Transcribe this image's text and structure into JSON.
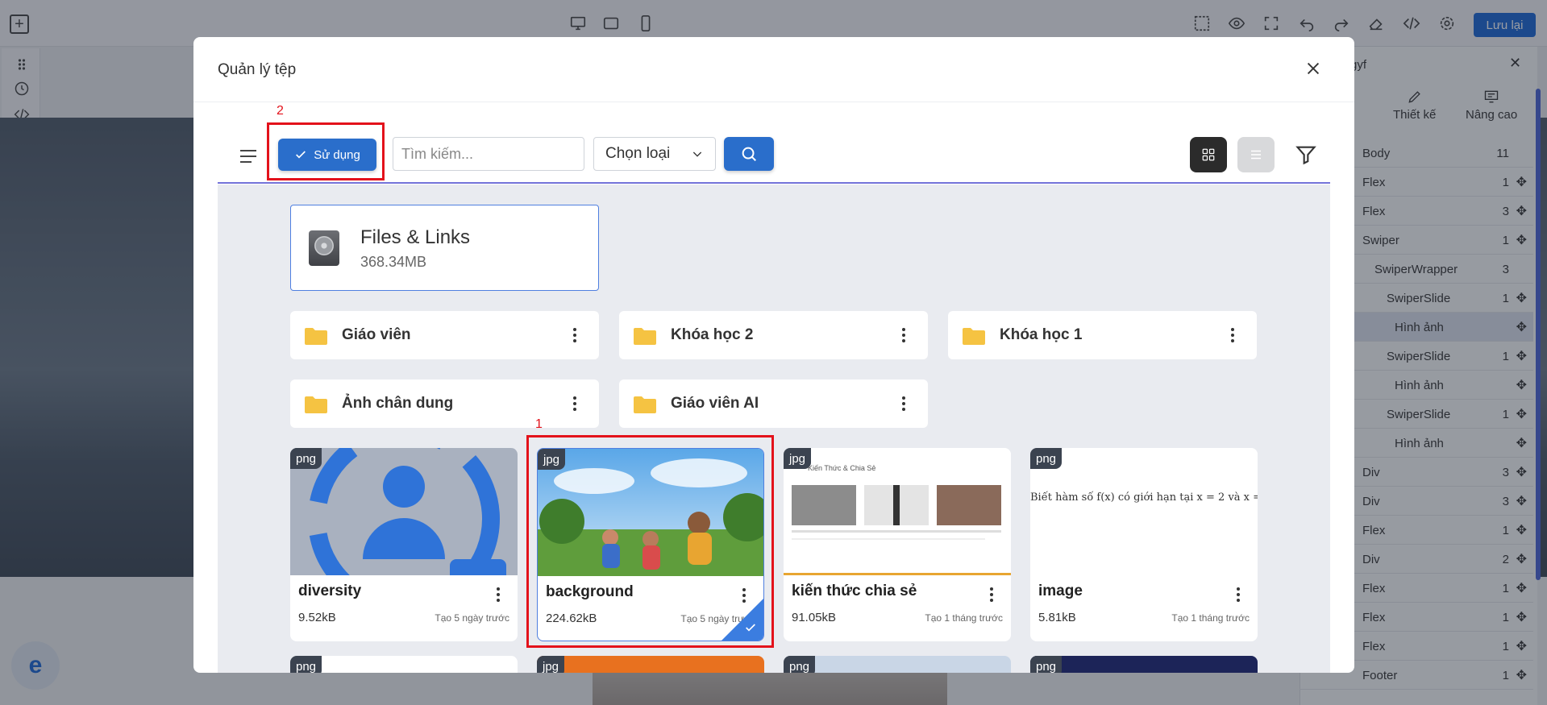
{
  "editor": {
    "save_label": "Lưu lại",
    "right_panel": {
      "header": "gyf",
      "tabs": [
        "Thiết kế",
        "Nâng cao"
      ],
      "tree": [
        {
          "label": "Body",
          "count": "11",
          "move": false
        },
        {
          "label": "Flex",
          "count": "1",
          "move": true
        },
        {
          "label": "Flex",
          "count": "3",
          "move": true
        },
        {
          "label": "Swiper",
          "count": "1",
          "move": true
        },
        {
          "label": "SwiperWrapper",
          "count": "3",
          "move": false
        },
        {
          "label": "SwiperSlide",
          "count": "1",
          "move": true
        },
        {
          "label": "Hình ảnh",
          "count": "",
          "move": true
        },
        {
          "label": "SwiperSlide",
          "count": "1",
          "move": true
        },
        {
          "label": "Hình ảnh",
          "count": "",
          "move": true
        },
        {
          "label": "SwiperSlide",
          "count": "1",
          "move": true
        },
        {
          "label": "Hình ảnh",
          "count": "",
          "move": true
        },
        {
          "label": "Div",
          "count": "3",
          "move": true
        },
        {
          "label": "Div",
          "count": "3",
          "move": true
        },
        {
          "label": "Flex",
          "count": "1",
          "move": true
        },
        {
          "label": "Div",
          "count": "2",
          "move": true
        },
        {
          "label": "Flex",
          "count": "1",
          "move": true
        },
        {
          "label": "Flex",
          "count": "1",
          "move": true
        },
        {
          "label": "Flex",
          "count": "1",
          "move": true
        },
        {
          "label": "Footer",
          "count": "1",
          "move": true
        }
      ]
    }
  },
  "modal": {
    "title": "Quản lý tệp",
    "use_label": "Sử dụng",
    "search_placeholder": "Tìm kiếm...",
    "type_label": "Chọn loại",
    "storage": {
      "name": "Files & Links",
      "size": "368.34MB"
    },
    "folders": [
      "Giáo viên",
      "Khóa học 2",
      "Khóa học 1",
      "Ảnh chân dung",
      "Giáo viên AI"
    ],
    "files": [
      {
        "type": "png",
        "name": "diversity",
        "size": "9.52kB",
        "date": "Tạo 5 ngày trước"
      },
      {
        "type": "jpg",
        "name": "background",
        "size": "224.62kB",
        "date": "Tạo 5 ngày trước"
      },
      {
        "type": "jpg",
        "name": "kiến thức chia sẻ",
        "size": "91.05kB",
        "date": "Tạo 1 tháng trước"
      },
      {
        "type": "png",
        "name": "image",
        "size": "5.81kB",
        "date": "Tạo 1 tháng trước"
      }
    ],
    "more_files": [
      "png",
      "jpg",
      "png",
      "png"
    ],
    "thumb_text": {
      "knowledge_header": "Kiến Thức & Chia Sẻ",
      "image_formula": "Biết hàm số f(x) có giới hạn tại x = 2 và x ="
    }
  },
  "annotations": {
    "one": "1",
    "two": "2"
  },
  "colors": {
    "primary": "#2a6ecb",
    "annotation": "#e3121b",
    "selection": "#4f7fe0"
  }
}
